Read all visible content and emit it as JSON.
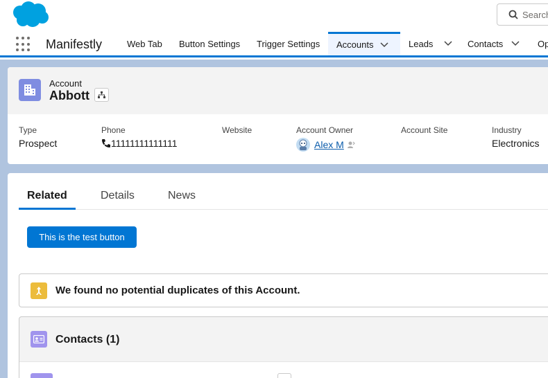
{
  "header": {
    "search_placeholder": "Search..."
  },
  "nav": {
    "app_name": "Manifestly",
    "items": [
      {
        "label": "Web Tab",
        "dropdown": false
      },
      {
        "label": "Button Settings",
        "dropdown": false
      },
      {
        "label": "Trigger Settings",
        "dropdown": false
      },
      {
        "label": "Accounts",
        "dropdown": true,
        "active": true
      },
      {
        "label": "Leads",
        "dropdown": true
      },
      {
        "label": "Contacts",
        "dropdown": true
      },
      {
        "label": "Op",
        "dropdown": false
      }
    ]
  },
  "record": {
    "entity_label": "Account",
    "name": "Abbott",
    "fields": [
      {
        "label": "Type",
        "value": "Prospect"
      },
      {
        "label": "Phone",
        "value": "11111111111111"
      },
      {
        "label": "Website",
        "value": ""
      },
      {
        "label": "Account Owner",
        "value": "Alex M"
      },
      {
        "label": "Account Site",
        "value": ""
      },
      {
        "label": "Industry",
        "value": "Electronics"
      }
    ]
  },
  "tabs": [
    {
      "label": "Related",
      "active": true
    },
    {
      "label": "Details"
    },
    {
      "label": "News"
    }
  ],
  "actions": {
    "test_button": "This is the test button"
  },
  "duplicates": {
    "message": "We found no potential duplicates of this Account."
  },
  "contacts": {
    "title": "Contacts (1)"
  },
  "colors": {
    "brand": "#0176d3",
    "account_icon": "#7f8de1",
    "contact_icon": "#a094ed",
    "duplicate_icon": "#ecbc3c",
    "page_background": "#b0c4df"
  }
}
